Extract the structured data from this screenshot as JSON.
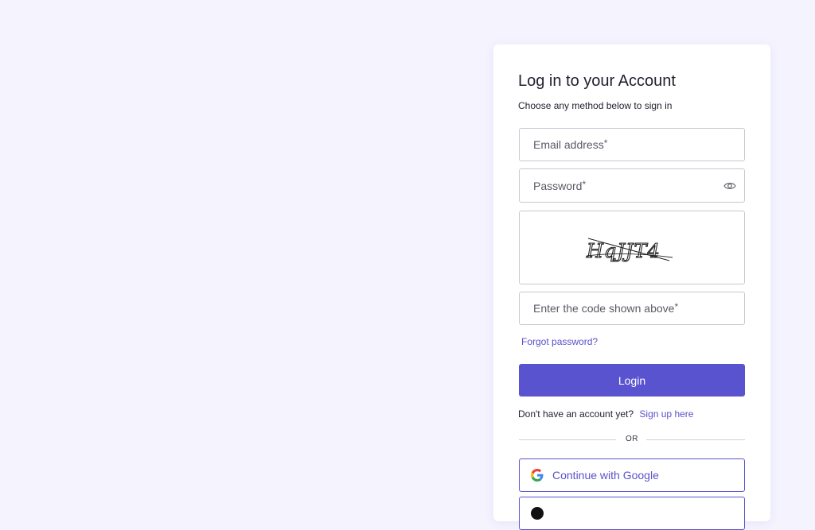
{
  "login": {
    "title": "Log in to your Account",
    "subtitle": "Choose any method below to sign in",
    "email": {
      "label": "Email address",
      "required_mark": "*"
    },
    "password": {
      "label": "Password",
      "required_mark": "*",
      "icon": "eye-icon"
    },
    "captcha": {
      "text": "HqJJT4"
    },
    "code": {
      "label": "Enter the code shown above",
      "required_mark": "*"
    },
    "forgot_label": "Forgot password?",
    "login_label": "Login",
    "signup_question": "Don't have an account yet?",
    "signup_link": "Sign up here",
    "divider_label": "OR",
    "google_label": "Continue with Google"
  },
  "colors": {
    "background": "#f4f3fe",
    "accent": "#5a53cf",
    "link": "#5a52c9"
  }
}
